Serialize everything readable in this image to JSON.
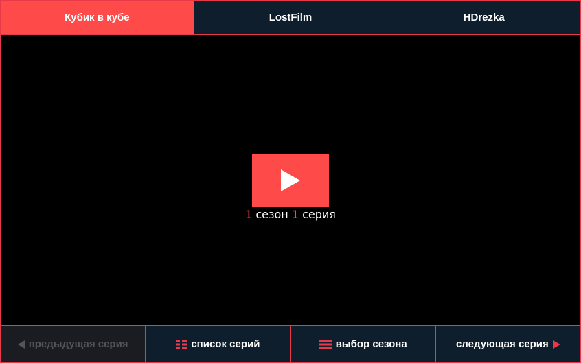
{
  "tabs": [
    {
      "label": "Кубик в кубе",
      "active": true
    },
    {
      "label": "LostFilm",
      "active": false
    },
    {
      "label": "HDrezka",
      "active": false
    }
  ],
  "player": {
    "season_number": "1",
    "season_label": "сезон",
    "episode_number": "1",
    "episode_label": "серия"
  },
  "controls": {
    "prev_label": "предыдущая серия",
    "list_label": "список серий",
    "season_select_label": "выбор сезона",
    "next_label": "следующая серия"
  },
  "icons": {
    "play": "play-icon",
    "prev": "triangle-left-icon",
    "list": "grid-list-icon",
    "season": "hamburger-icon",
    "next": "triangle-right-icon"
  },
  "colors": {
    "accent": "#ff4a4a",
    "bar_background": "#0f1e2d",
    "border": "#e8394a",
    "disabled_background": "#1b1c21",
    "disabled_text": "#50555c"
  }
}
